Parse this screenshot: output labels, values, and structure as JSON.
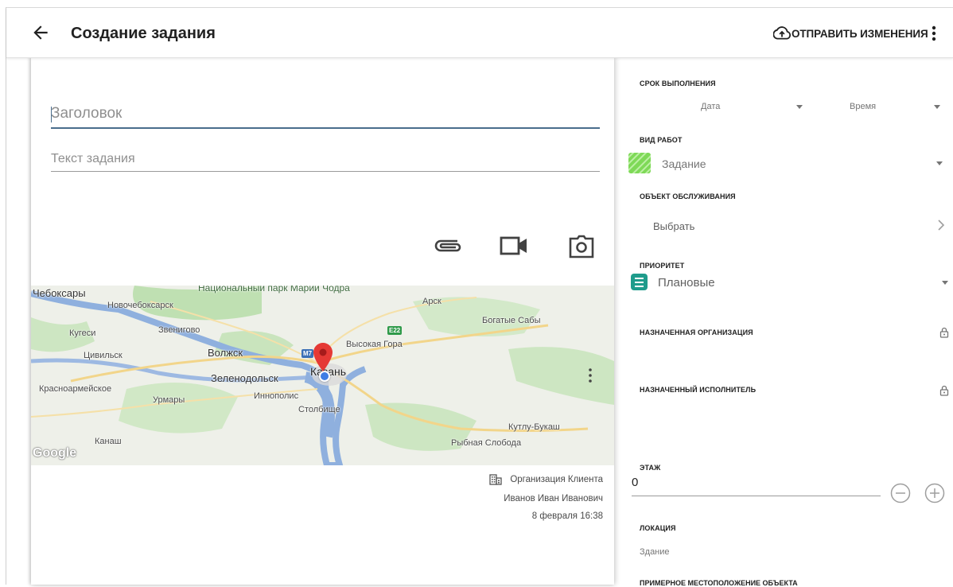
{
  "header": {
    "title": "Создание задания",
    "submit_label": "ОТПРАВИТЬ ИЗМЕНЕНИЯ"
  },
  "form": {
    "title_placeholder": "Заголовок",
    "text_placeholder": "Текст задания"
  },
  "map": {
    "labels": {
      "cheboksary": "Чебоксары",
      "novocheboksarsk": "Новочебоксарск",
      "park": "Национальный парк Марий Чодра",
      "arsk": "Арск",
      "kugesi": "Кугеси",
      "zvenigovo": "Звенигово",
      "vysokaya_gora": "Высокая Гора",
      "bogatye_saby": "Богатые Сабы",
      "tsivilsk": "Цивильск",
      "volzhsk": "Волжск",
      "zelenodolsk": "Зеленодольск",
      "kazan": "Казань",
      "krasnoarmeyskoe": "Красноармейское",
      "urmary": "Урмары",
      "innopolis": "Иннополис",
      "stolbische": "Столбище",
      "kutlu_bukash": "Кутлу-Букаш",
      "kanash": "Канаш",
      "rybnaya_sloboda": "Рыбная Слобода",
      "google": "Google"
    },
    "shields": {
      "m7": "M7",
      "e22": "E22"
    }
  },
  "meta": {
    "organization": "Организация Клиента",
    "user": "Иванов Иван Иванович",
    "date": "8 февраля 16:38"
  },
  "panel": {
    "deadline": {
      "label": "СРОК ВЫПОЛНЕНИЯ",
      "date": "Дата",
      "time": "Время"
    },
    "work_type": {
      "label": "ВИД РАБОТ",
      "value": "Задание"
    },
    "service_object": {
      "label": "ОБЪЕКТ ОБСЛУЖИВАНИЯ",
      "value": "Выбрать"
    },
    "priority": {
      "label": "ПРИОРИТЕТ",
      "value": "Плановые"
    },
    "assigned_org": {
      "label": "НАЗНАЧЕННАЯ ОРГАНИЗАЦИЯ"
    },
    "assigned_exec": {
      "label": "НАЗНАЧЕННЫЙ ИСПОЛНИТЕЛЬ"
    },
    "floor": {
      "label": "ЭТАЖ",
      "value": "0"
    },
    "location": {
      "label": "ЛОКАЦИЯ",
      "value": "Здание"
    },
    "approx_location": {
      "label": "ПРИМЕРНОЕ МЕСТОПОЛОЖЕНИЕ ОБЪЕКТА"
    }
  },
  "colors": {
    "accent": "#4a6d8c",
    "work_type_swatch": "#7ed957",
    "priority_icon": "#1f9c8c",
    "map_pin": "#e53935"
  }
}
